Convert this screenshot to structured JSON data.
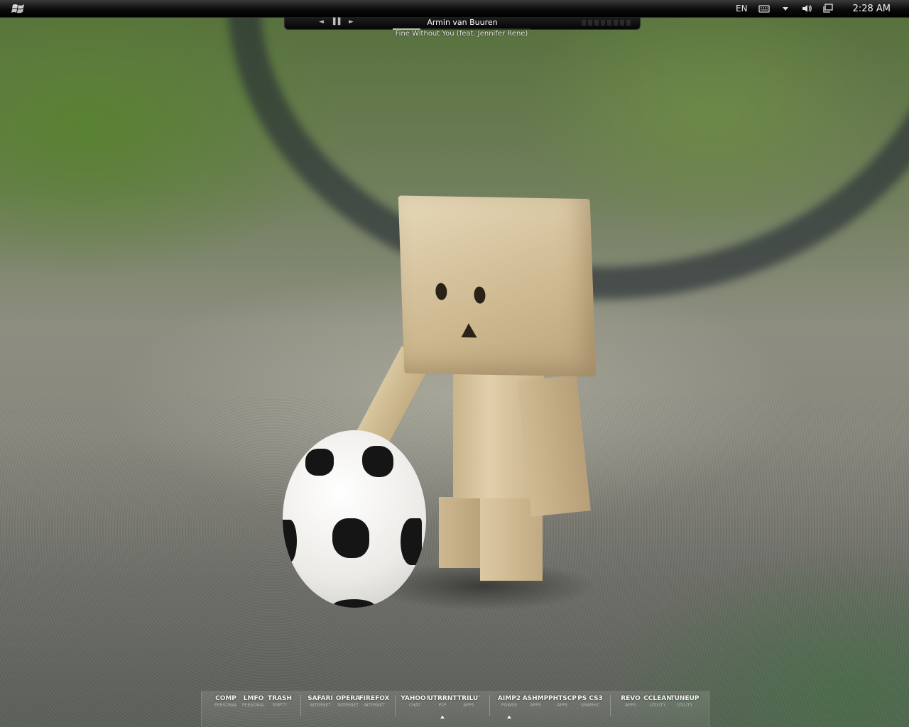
{
  "taskbar": {
    "start_icon": "windows-logo-icon",
    "language": "EN",
    "tray_icons": [
      "keyboard-icon",
      "chevron-down-icon",
      "speaker-icon",
      "network-icon"
    ],
    "clock": "2:28 AM"
  },
  "player": {
    "controls": {
      "prev": "◄",
      "pause": "▌▌",
      "next": "►"
    },
    "artist": "Armin van Buuren",
    "track": "Fine Without You (feat. Jennifer Rene)",
    "progress": 0.2
  },
  "dock": {
    "groups": [
      {
        "items": [
          {
            "label": "COMP",
            "sub": "PERSONAL"
          },
          {
            "label": "LMFO",
            "sub": "PERSONAL"
          },
          {
            "label": "TRASH",
            "sub": "EMPTY"
          }
        ]
      },
      {
        "items": [
          {
            "label": "SAFARI",
            "sub": "INTERNET"
          },
          {
            "label": "OPERA",
            "sub": "INTERNET"
          },
          {
            "label": "FIREFOX",
            "sub": "INTERNET"
          }
        ]
      },
      {
        "items": [
          {
            "label": "YAHOO!",
            "sub": "CHAT"
          },
          {
            "label": "UTRRNT",
            "sub": "P2P"
          },
          {
            "label": "TRILU'",
            "sub": "APPS"
          }
        ]
      },
      {
        "items": [
          {
            "label": "AIMP2",
            "sub": "POWER"
          },
          {
            "label": "ASHMP",
            "sub": "APPS"
          },
          {
            "label": "PHTSCP",
            "sub": "APPS"
          },
          {
            "label": "PS CS3",
            "sub": "GRAPHIC"
          }
        ]
      },
      {
        "items": [
          {
            "label": "REVO",
            "sub": "APPS"
          },
          {
            "label": "CCLEAN",
            "sub": "UTILITY"
          },
          {
            "label": "TUNEUP",
            "sub": "UTILITY"
          }
        ]
      }
    ]
  }
}
